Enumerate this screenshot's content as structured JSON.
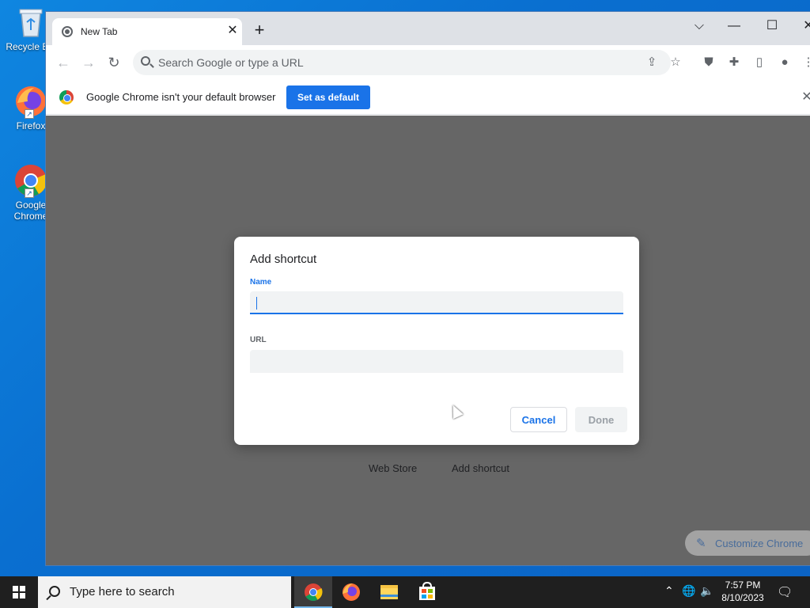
{
  "desktop": {
    "icons": [
      {
        "label": "Recycle Bin",
        "icon": "recycle-bin-icon"
      },
      {
        "label": "Firefox",
        "icon": "firefox-icon"
      },
      {
        "label": "Google Chrome",
        "icon": "chrome-icon"
      }
    ]
  },
  "browser": {
    "tab": {
      "title": "New Tab",
      "close_glyph": "✕"
    },
    "new_tab_glyph": "+",
    "window_controls": {
      "dropdown": "⌵",
      "minimize": "—",
      "maximize": "☐",
      "close": "✕"
    },
    "toolbar": {
      "back": "←",
      "forward": "→",
      "reload": "↻",
      "omnibox_placeholder": "Search Google or type a URL",
      "share": "⇪",
      "star": "☆",
      "ublock": "⛊",
      "extensions": "✚",
      "sidepanel": "▯",
      "profile": "●",
      "menu": "⋮"
    },
    "infobar": {
      "message": "Google Chrome isn't your default browser",
      "button": "Set as default",
      "close": "✕"
    },
    "page": {
      "shortcuts": [
        {
          "label": "Web Store"
        },
        {
          "label": "Add shortcut"
        }
      ],
      "customize_label": "Customize Chrome",
      "customize_icon": "✎"
    }
  },
  "dialog": {
    "title": "Add shortcut",
    "name_label": "Name",
    "name_value": "",
    "url_label": "URL",
    "url_value": "",
    "cancel": "Cancel",
    "done": "Done"
  },
  "taskbar": {
    "search_placeholder": "Type here to search",
    "apps": [
      {
        "name": "chrome-icon",
        "active": true
      },
      {
        "name": "firefox-icon",
        "active": false
      },
      {
        "name": "file-explorer-icon",
        "active": false
      },
      {
        "name": "store-icon",
        "active": false
      }
    ],
    "tray": {
      "chevron": "⌃",
      "network": "🌐",
      "volume": "🔈",
      "notification": "🗨"
    },
    "time": "7:57 PM",
    "date": "8/10/2023"
  },
  "colors": {
    "accent": "#1a73e8",
    "desktop": "#0a7ad6",
    "taskbar": "#1f1f1f"
  }
}
